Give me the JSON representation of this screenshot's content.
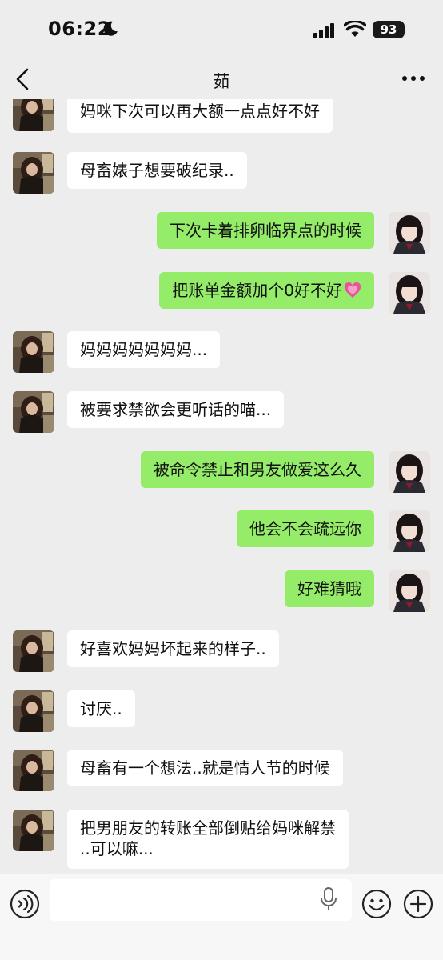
{
  "status_bar": {
    "time": "06:22",
    "battery": "93",
    "icons": [
      "moon-icon",
      "signal-icon",
      "wifi-icon",
      "battery-icon"
    ]
  },
  "header": {
    "title": "茹",
    "icons": [
      "chevron-left-icon",
      "more-icon"
    ]
  },
  "messages": [
    {
      "side": "in",
      "text": "妈咪下次可以再大额一点点好不好"
    },
    {
      "side": "in",
      "text": "母畜婊子想要破纪录.."
    },
    {
      "side": "out",
      "text": "下次卡着排卵临界点的时候"
    },
    {
      "side": "out",
      "text": "把账单金额加个0好不好",
      "emoji": "heart-emoji"
    },
    {
      "side": "in",
      "text": "妈妈妈妈妈妈妈..."
    },
    {
      "side": "in",
      "text": "被要求禁欲会更听话的喵..."
    },
    {
      "side": "out",
      "text": "被命令禁止和男友做爱这么久"
    },
    {
      "side": "out",
      "text": "他会不会疏远你"
    },
    {
      "side": "out",
      "text": "好难猜哦"
    },
    {
      "side": "in",
      "text": "好喜欢妈妈坏起来的样子.."
    },
    {
      "side": "in",
      "text": "讨厌.."
    },
    {
      "side": "in",
      "text": "母畜有一个想法..就是情人节的时候"
    },
    {
      "side": "in",
      "text_lines": [
        "把男朋友的转账全部倒贴给妈咪解禁",
        "..可以嘛..."
      ]
    }
  ],
  "input_bar": {
    "value": "",
    "icons": [
      "voice-icon",
      "mic-icon",
      "emoji-icon",
      "plus-icon"
    ]
  },
  "colors": {
    "background": "#ededed",
    "incoming_bubble": "#ffffff",
    "outgoing_bubble": "#95ec69",
    "input_bar": "#f7f7f7"
  }
}
